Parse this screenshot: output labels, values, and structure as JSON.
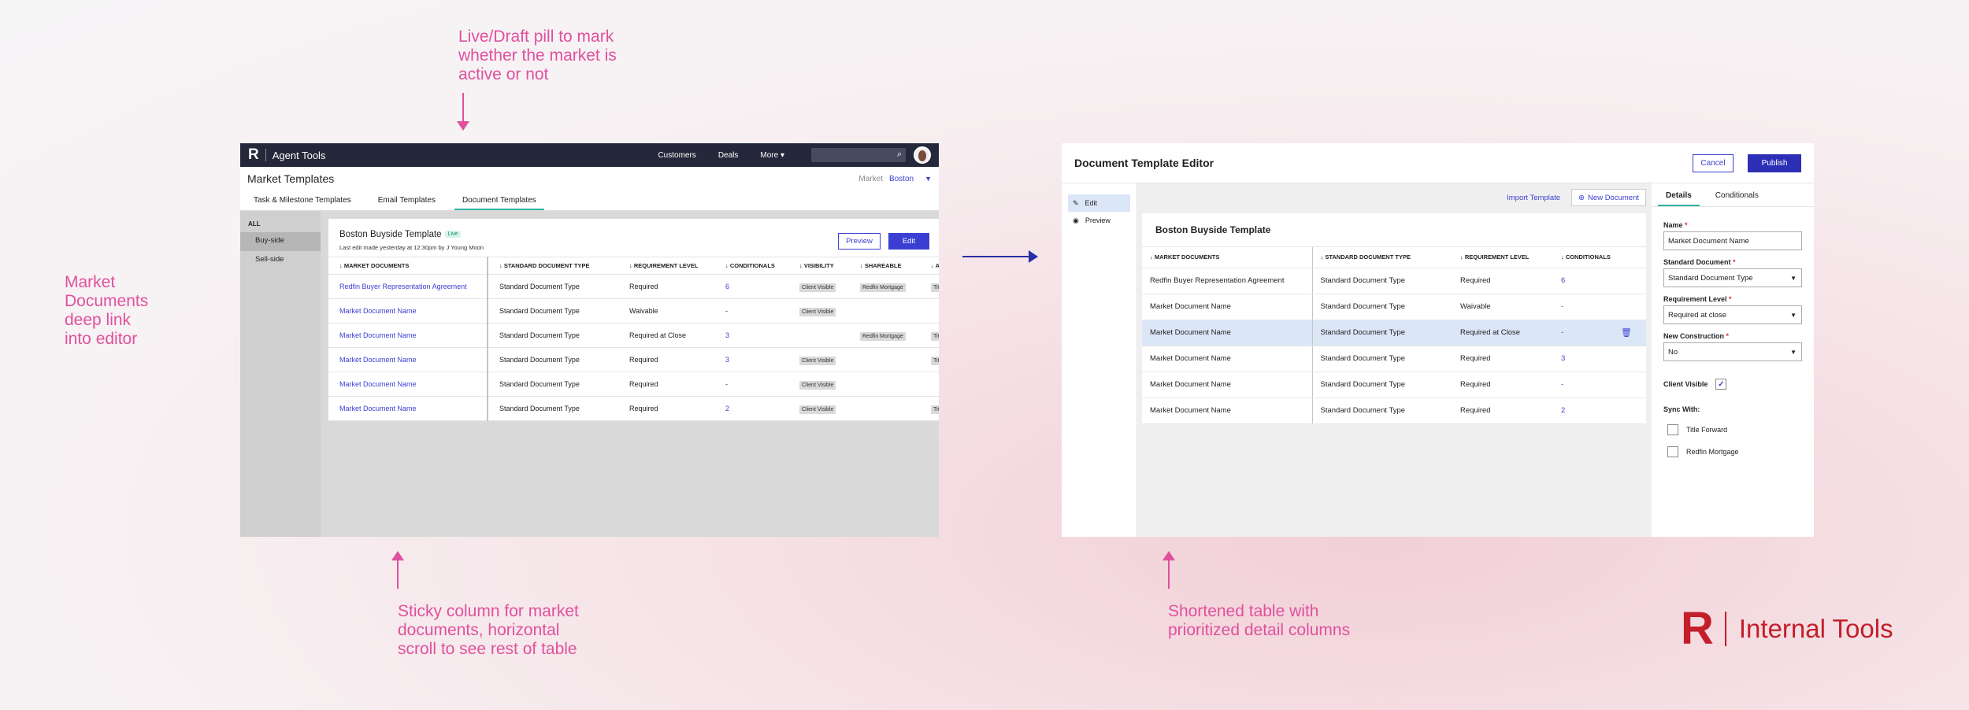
{
  "annotations": {
    "live_draft": [
      "Live/Draft pill to mark",
      "whether the market is",
      "active or not"
    ],
    "deep_link": [
      "Market",
      "Documents",
      "deep link",
      "into editor"
    ],
    "sticky": [
      "Sticky column for market",
      "documents, horizontal",
      "scroll to see rest of table"
    ],
    "shortened": [
      "Shortened table with",
      "prioritized detail columns"
    ]
  },
  "agent_tools": {
    "logo": "R",
    "app_name": "Agent Tools",
    "nav": [
      "Customers",
      "Deals",
      "More"
    ],
    "page_title": "Market Templates",
    "market_label": "Market",
    "market_value": "Boston",
    "tabs": [
      "Task & Milestone Templates",
      "Email Templates",
      "Document Templates"
    ],
    "sidebar": {
      "group": "ALL",
      "items": [
        "Buy-side",
        "Sell-side"
      ]
    },
    "template_title": "Boston Buyside Template",
    "live_pill": "Live",
    "last_edit": "Last edit made yesterday at 12:30pm by J Young Moon",
    "preview": "Preview",
    "edit": "Edit",
    "columns": [
      "MARKET DOCUMENTS",
      "STANDARD DOCUMENT TYPE",
      "REQUIREMENT LEVEL",
      "CONDITIONALS",
      "VISIBILITY",
      "SHAREABLE",
      "AU"
    ],
    "rows": [
      [
        "Redfin Buyer Representation Agreement",
        "Standard Document Type",
        "Required",
        "6",
        "Client Visible",
        "Redfin Mortgage",
        "Title"
      ],
      [
        "Market Document Name",
        "Standard Document Type",
        "Waivable",
        "-",
        "Client Visible",
        "",
        ""
      ],
      [
        "Market Document Name",
        "Standard Document Type",
        "Required at Close",
        "3",
        "",
        "Redfin Mortgage",
        "Title"
      ],
      [
        "Market Document Name",
        "Standard Document Type",
        "Required",
        "3",
        "Client Visible",
        "",
        "Title"
      ],
      [
        "Market Document Name",
        "Standard Document Type",
        "Required",
        "-",
        "Client Visible",
        "",
        ""
      ],
      [
        "Market Document Name",
        "Standard Document Type",
        "Required",
        "2",
        "Client Visible",
        "",
        "Title"
      ]
    ]
  },
  "editor": {
    "title": "Document Template Editor",
    "cancel": "Cancel",
    "publish": "Publish",
    "side": [
      "Edit",
      "Preview"
    ],
    "import": "Import Template",
    "new_doc": "New Document",
    "card_title": "Boston Buyside Template",
    "columns": [
      "MARKET DOCUMENTS",
      "STANDARD DOCUMENT TYPE",
      "REQUIREMENT LEVEL",
      "CONDITIONALS"
    ],
    "rows": [
      [
        "Redfin Buyer Representation Agreement",
        "Standard Document Type",
        "Required",
        "6"
      ],
      [
        "Market Document Name",
        "Standard Document Type",
        "Waivable",
        "-"
      ],
      [
        "Market Document Name",
        "Standard Document Type",
        "Required at Close",
        "-"
      ],
      [
        "Market Document Name",
        "Standard Document Type",
        "Required",
        "3"
      ],
      [
        "Market Document Name",
        "Standard Document Type",
        "Required",
        "-"
      ],
      [
        "Market Document Name",
        "Standard Document Type",
        "Required",
        "2"
      ]
    ],
    "panel_tabs": [
      "Details",
      "Conditionals"
    ],
    "form": {
      "name_label": "Name",
      "name_value": "Market Document Name",
      "std_label": "Standard Document",
      "std_value": "Standard Document Type",
      "req_label": "Requirement Level",
      "req_value": "Required at close",
      "new_label": "New Construction",
      "new_value": "No",
      "client_visible": "Client Visible",
      "sync_with": "Sync With:",
      "sync_options": [
        "Title Forward",
        "Redfin Mortgage"
      ],
      "required_mark": "*"
    }
  },
  "brand": {
    "logo": "R",
    "text": "Internal Tools"
  },
  "colors": {
    "accent": "#3b3fd1",
    "annotation": "#e0509e",
    "brand": "#c41e2b",
    "highlight": "#dbe6f7"
  }
}
